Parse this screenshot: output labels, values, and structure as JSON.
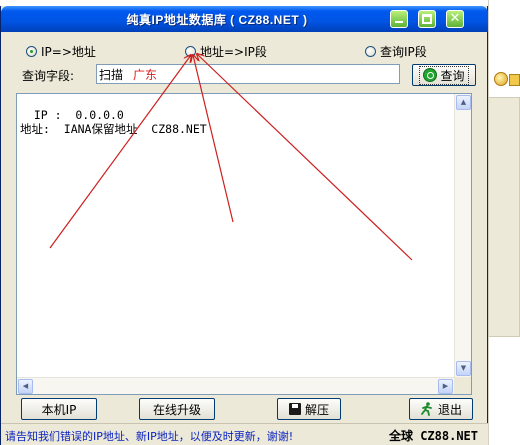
{
  "window": {
    "title": "纯真IP地址数据库 ( CZ88.NET )",
    "controls": [
      "minimize-icon",
      "maximize-icon",
      "close-icon"
    ]
  },
  "radios": {
    "ip_to_address": "IP=>地址",
    "address_to_ip": "地址=>IP段",
    "query_ip_range": "查询IP段",
    "selected": "ip_to_address"
  },
  "query": {
    "label": "查询字段:",
    "input_value": "扫描",
    "ime_candidate": "广东",
    "button_label": "查询"
  },
  "result": {
    "ip_line": "  IP :  0.0.0.0",
    "address_line": "地址:  IANA保留地址  CZ88.NET"
  },
  "buttons": {
    "local_ip": "本机IP",
    "online_upgrade": "在线升级",
    "unzip": "解压",
    "exit": "退出"
  },
  "status": {
    "message": "请告知我们错误的IP地址、新IP地址，以便及时更新，谢谢!",
    "brand": "全球  CZ88.NET"
  },
  "colors": {
    "title_bar": "#0054e3",
    "status_text": "#0a22c0",
    "arrow": "#cc1f1f",
    "ime_text": "#dd2222"
  }
}
